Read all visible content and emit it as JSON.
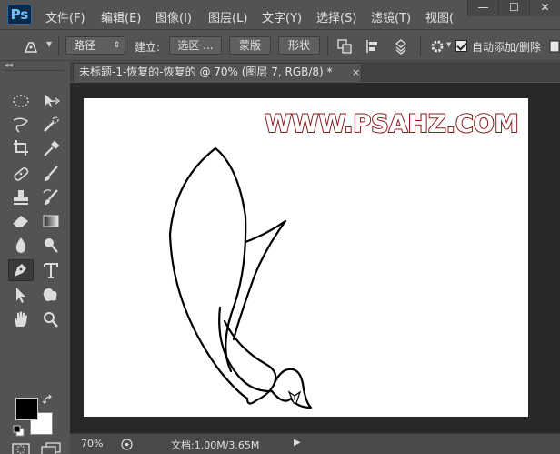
{
  "app": {
    "logo": "Ps"
  },
  "menu": [
    "文件(F)",
    "编辑(E)",
    "图像(I)",
    "图层(L)",
    "文字(Y)",
    "选择(S)",
    "滤镜(T)",
    "视图("
  ],
  "window_buttons": [
    "—",
    "☐",
    "✕"
  ],
  "options": {
    "mode_select": "路径",
    "build_label": "建立:",
    "selection_btn": "选区 ...",
    "mask_btn": "蒙版",
    "shape_btn": "形状",
    "auto_add_delete": "自动添加/删除",
    "auto_add_checked": true
  },
  "document": {
    "tab_title": "未标题-1-恢复的-恢复的 @ 70% (图层 7, RGB/8) *",
    "close": "×"
  },
  "canvas": {
    "watermark": "WWW.PSAHZ.COM"
  },
  "status": {
    "zoom": "70%",
    "doc_info": "文档:1.00M/3.65M"
  },
  "colors": {
    "foreground": "#000000",
    "background": "#ffffff",
    "watermark_stroke": "#8b1a1a"
  },
  "toolbox": {
    "collapse": "◂◂",
    "tools": [
      "marquee-tool",
      "move-tool",
      "lasso-tool",
      "quick-select-tool",
      "crop-tool",
      "eyedropper-tool",
      "healing-brush-tool",
      "brush-tool",
      "clone-stamp-tool",
      "history-brush-tool",
      "eraser-tool",
      "gradient-tool",
      "blur-tool",
      "dodge-tool",
      "pen-tool",
      "type-tool",
      "path-select-tool",
      "custom-shape-tool",
      "hand-tool",
      "zoom-tool"
    ],
    "active_tool": "pen-tool"
  }
}
